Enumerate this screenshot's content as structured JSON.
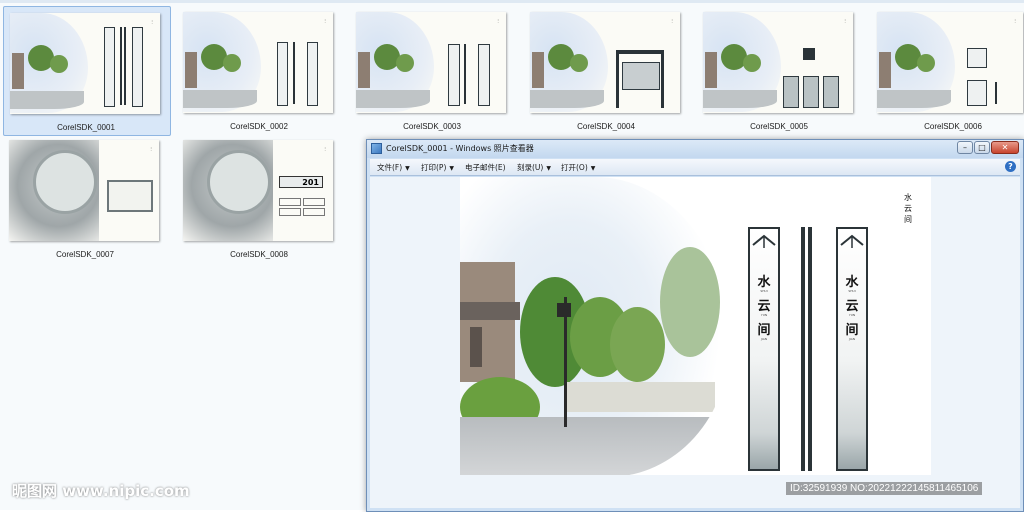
{
  "explorer": {
    "items": [
      {
        "label": "CorelSDK_0001",
        "selected": true
      },
      {
        "label": "CorelSDK_0002",
        "selected": false
      },
      {
        "label": "CorelSDK_0003",
        "selected": false
      },
      {
        "label": "CorelSDK_0004",
        "selected": false
      },
      {
        "label": "CorelSDK_0005",
        "selected": false
      },
      {
        "label": "CorelSDK_0006",
        "selected": false
      },
      {
        "label": "CorelSDK_0007",
        "selected": false
      },
      {
        "label": "CorelSDK_0008",
        "selected": false
      }
    ],
    "room_number": "201"
  },
  "viewer": {
    "title": "CorelSDK_0001 - Windows 照片查看器",
    "menu": [
      "文件(F)",
      "打印(P)",
      "电子邮件(E)",
      "刻录(U)",
      "打开(O)"
    ],
    "window_buttons": {
      "minimize": "–",
      "maximize": "□",
      "close": "✕"
    },
    "help": "?"
  },
  "sign": {
    "chars": [
      "水",
      "云",
      "间"
    ],
    "pinyin": [
      "SHUI",
      "YUN",
      "JIAN"
    ]
  },
  "seal": [
    "水",
    "云",
    "间"
  ],
  "watermark": {
    "left": "昵图网 www.nipic.com",
    "right": "ID:32591939 NO:20221222145811465106"
  },
  "colors": {
    "accent": "#2b3438",
    "window_frame": "#6e8fb8",
    "close_red": "#c8442e"
  }
}
